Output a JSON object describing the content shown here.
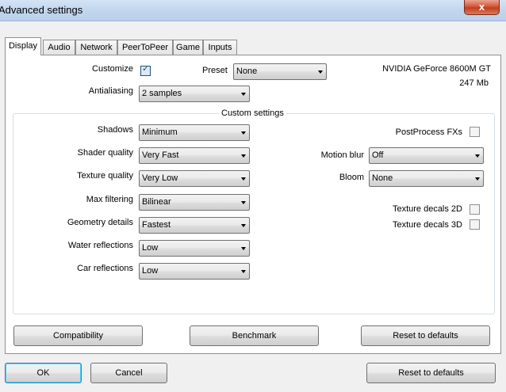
{
  "window": {
    "title": "Advanced settings",
    "close_glyph": "x"
  },
  "tabs": [
    {
      "label": "Display",
      "active": true
    },
    {
      "label": "Audio"
    },
    {
      "label": "Network"
    },
    {
      "label": "PeerToPeer"
    },
    {
      "label": "Game"
    },
    {
      "label": "Inputs"
    }
  ],
  "display": {
    "customize_label": "Customize",
    "customize_checked": true,
    "preset_label": "Preset",
    "preset_value": "None",
    "antialiasing_label": "Antialiasing",
    "antialiasing_value": "2 samples",
    "gpu_name": "NVIDIA GeForce 8600M GT",
    "gpu_memory": "247 Mb"
  },
  "custom": {
    "group_title": "Custom settings",
    "shadows_label": "Shadows",
    "shadows_value": "Minimum",
    "shader_label": "Shader quality",
    "shader_value": "Very Fast",
    "texture_label": "Texture quality",
    "texture_value": "Very Low",
    "filtering_label": "Max filtering",
    "filtering_value": "Bilinear",
    "geometry_label": "Geometry details",
    "geometry_value": "Fastest",
    "water_label": "Water reflections",
    "water_value": "Low",
    "car_label": "Car reflections",
    "car_value": "Low",
    "postprocess_label": "PostProcess FXs",
    "postprocess_checked": false,
    "motionblur_label": "Motion blur",
    "motionblur_value": "Off",
    "bloom_label": "Bloom",
    "bloom_value": "None",
    "decals2d_label": "Texture decals 2D",
    "decals2d_checked": false,
    "decals3d_label": "Texture decals 3D",
    "decals3d_checked": false
  },
  "panel_buttons": {
    "compatibility": "Compatibility",
    "benchmark": "Benchmark",
    "reset": "Reset to defaults"
  },
  "dialog_buttons": {
    "ok": "OK",
    "cancel": "Cancel",
    "reset": "Reset to defaults"
  },
  "icons": {
    "check": "check-icon",
    "dropdown": "chevron-down-icon",
    "close": "close-icon"
  }
}
